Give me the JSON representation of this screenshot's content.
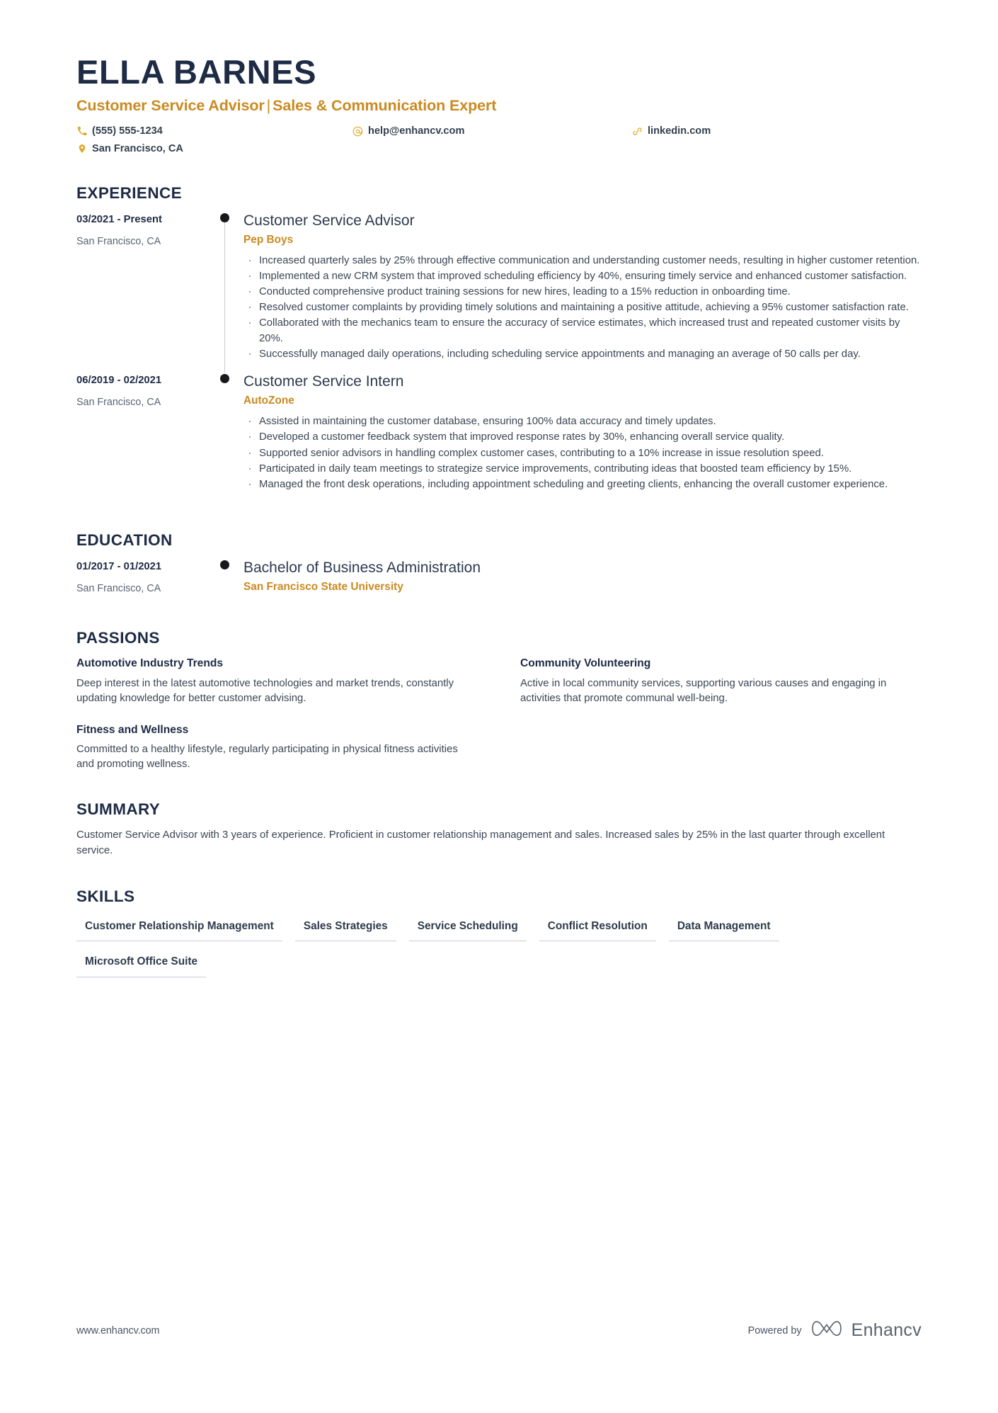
{
  "header": {
    "name": "ELLA BARNES",
    "headline_left": "Customer Service Advisor",
    "headline_divider": "|",
    "headline_right": "Sales & Communication Expert",
    "contacts": [
      {
        "icon": "phone-icon",
        "text": "(555) 555-1234"
      },
      {
        "icon": "email-icon",
        "text": "help@enhancv.com"
      },
      {
        "icon": "link-icon",
        "text": "linkedin.com"
      },
      {
        "icon": "location-pin-icon",
        "text": "San Francisco, CA"
      }
    ]
  },
  "experience": {
    "title": "EXPERIENCE",
    "entries": [
      {
        "date": "03/2021 - Present",
        "location": "San Francisco, CA",
        "role": "Customer Service Advisor",
        "company": "Pep Boys",
        "bullets": [
          "Increased quarterly sales by 25% through effective communication and understanding customer needs, resulting in higher customer retention.",
          "Implemented a new CRM system that improved scheduling efficiency by 40%, ensuring timely service and enhanced customer satisfaction.",
          "Conducted comprehensive product training sessions for new hires, leading to a 15% reduction in onboarding time.",
          "Resolved customer complaints by providing timely solutions and maintaining a positive attitude, achieving a 95% customer satisfaction rate.",
          "Collaborated with the mechanics team to ensure the accuracy of service estimates, which increased trust and repeated customer visits by 20%.",
          "Successfully managed daily operations, including scheduling service appointments and managing an average of 50 calls per day."
        ]
      },
      {
        "date": "06/2019 - 02/2021",
        "location": "San Francisco, CA",
        "role": "Customer Service Intern",
        "company": "AutoZone",
        "bullets": [
          "Assisted in maintaining the customer database, ensuring 100% data accuracy and timely updates.",
          "Developed a customer feedback system that improved response rates by 30%, enhancing overall service quality.",
          "Supported senior advisors in handling complex customer cases, contributing to a 10% increase in issue resolution speed.",
          "Participated in daily team meetings to strategize service improvements, contributing ideas that boosted team efficiency by 15%.",
          "Managed the front desk operations, including appointment scheduling and greeting clients, enhancing the overall customer experience."
        ]
      }
    ]
  },
  "education": {
    "title": "EDUCATION",
    "entries": [
      {
        "date": "01/2017 - 01/2021",
        "location": "San Francisco, CA",
        "degree": "Bachelor of Business Administration",
        "school": "San Francisco State University"
      }
    ]
  },
  "passions": {
    "title": "PASSIONS",
    "items": [
      {
        "title": "Automotive Industry Trends",
        "text": "Deep interest in the latest automotive technologies and market trends, constantly updating knowledge for better customer advising."
      },
      {
        "title": "Community Volunteering",
        "text": "Active in local community services, supporting various causes and engaging in activities that promote communal well-being."
      },
      {
        "title": "Fitness and Wellness",
        "text": "Committed to a healthy lifestyle, regularly participating in physical fitness activities and promoting wellness."
      }
    ]
  },
  "summary": {
    "title": "SUMMARY",
    "text": "Customer Service Advisor with 3 years of experience. Proficient in customer relationship management and sales. Increased sales by 25% in the last quarter through excellent service."
  },
  "skills": {
    "title": "SKILLS",
    "items": [
      "Customer Relationship Management",
      "Sales Strategies",
      "Service Scheduling",
      "Conflict Resolution",
      "Data Management",
      "Microsoft Office Suite"
    ]
  },
  "footer": {
    "url": "www.enhancv.com",
    "powered_by": "Powered by",
    "brand": "Enhancv"
  },
  "colors": {
    "accent": "#ca8a21",
    "navy": "#1e2b45",
    "body": "#3b4654",
    "rail": "#c9ccd2"
  }
}
